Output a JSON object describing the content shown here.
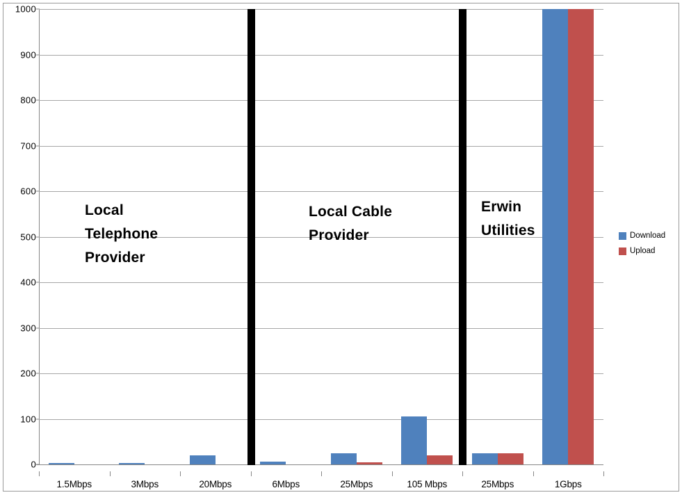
{
  "chart_data": {
    "type": "bar",
    "title": "",
    "xlabel": "",
    "ylabel": "",
    "ylim": [
      0,
      1000
    ],
    "ytick_values": [
      0,
      100,
      200,
      300,
      400,
      500,
      600,
      700,
      800,
      900,
      1000
    ],
    "ytick_labels": [
      "0",
      "100",
      "200",
      "300",
      "400",
      "500",
      "600",
      "700",
      "800",
      "900",
      "1000"
    ],
    "grid": true,
    "legend_position": "right",
    "categories": [
      "1.5Mbps",
      "3Mbps",
      "20Mbps",
      "6Mbps",
      "25Mbps",
      "105 Mbps",
      "25Mbps",
      "1Gbps"
    ],
    "series": [
      {
        "name": "Download",
        "color": "#4f81bd",
        "values": [
          1.5,
          3,
          20,
          6,
          25,
          105,
          25,
          1000
        ]
      },
      {
        "name": "Upload",
        "color": "#c0504d",
        "values": [
          0,
          0,
          0,
          0,
          4,
          20,
          25,
          1000
        ]
      }
    ],
    "annotations": [
      {
        "text": "Local\nTelephone\nProvider",
        "after_category_index": 2
      },
      {
        "text": "Local Cable\nProvider",
        "after_category_index": 5
      },
      {
        "text": "Erwin\nUtilities",
        "after_category_index": 7
      }
    ],
    "separators": [
      {
        "label": "group-divider-1",
        "after_category_index": 2
      },
      {
        "label": "group-divider-2",
        "after_category_index": 5
      }
    ]
  },
  "legend": {
    "items": [
      {
        "label": "Download",
        "color": "#4f81bd"
      },
      {
        "label": "Upload",
        "color": "#c0504d"
      }
    ]
  },
  "annotations": {
    "telephone": "Local\nTelephone\nProvider",
    "cable": "Local Cable\nProvider",
    "erwin": "Erwin\nUtilities"
  }
}
